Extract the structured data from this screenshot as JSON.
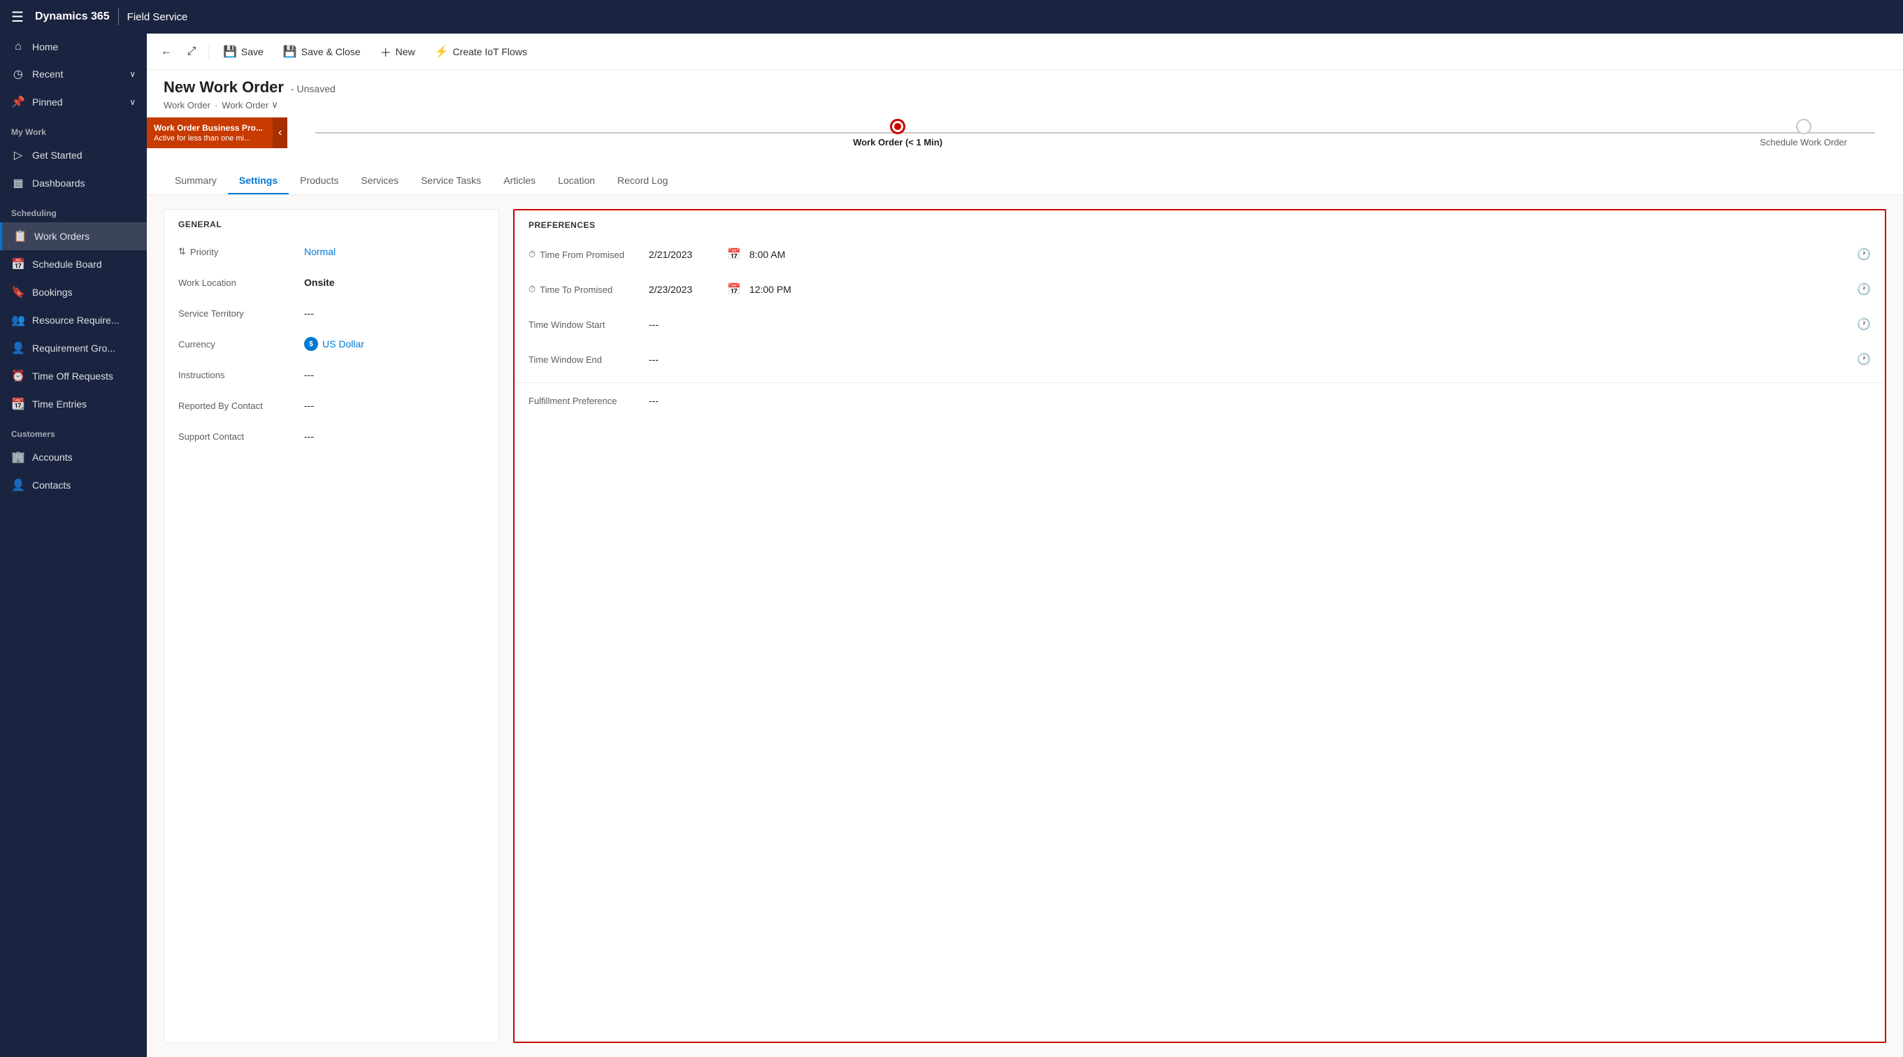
{
  "topNav": {
    "hamburger": "☰",
    "title": "Dynamics 365",
    "appName": "Field Service"
  },
  "sidebar": {
    "items": [
      {
        "id": "home",
        "icon": "⌂",
        "label": "Home",
        "expand": false
      },
      {
        "id": "recent",
        "icon": "◷",
        "label": "Recent",
        "expand": true
      },
      {
        "id": "pinned",
        "icon": "📌",
        "label": "Pinned",
        "expand": true
      }
    ],
    "sections": [
      {
        "label": "My Work",
        "items": [
          {
            "id": "get-started",
            "icon": "▷",
            "label": "Get Started"
          },
          {
            "id": "dashboards",
            "icon": "▦",
            "label": "Dashboards"
          }
        ]
      },
      {
        "label": "Scheduling",
        "items": [
          {
            "id": "work-orders",
            "icon": "📋",
            "label": "Work Orders",
            "active": true
          },
          {
            "id": "schedule-board",
            "icon": "📅",
            "label": "Schedule Board"
          },
          {
            "id": "bookings",
            "icon": "🔖",
            "label": "Bookings"
          },
          {
            "id": "resource-requirements",
            "icon": "👥",
            "label": "Resource Require..."
          },
          {
            "id": "requirement-groups",
            "icon": "👤",
            "label": "Requirement Gro..."
          },
          {
            "id": "time-off-requests",
            "icon": "⏰",
            "label": "Time Off Requests"
          },
          {
            "id": "time-entries",
            "icon": "📆",
            "label": "Time Entries"
          }
        ]
      },
      {
        "label": "Customers",
        "items": [
          {
            "id": "accounts",
            "icon": "🏢",
            "label": "Accounts"
          },
          {
            "id": "contacts",
            "icon": "👤",
            "label": "Contacts"
          }
        ]
      }
    ]
  },
  "commandBar": {
    "backLabel": "←",
    "popoutLabel": "⤢",
    "saveLabel": "Save",
    "saveCloseLabel": "Save & Close",
    "newLabel": "New",
    "iotLabel": "Create IoT Flows"
  },
  "pageHeader": {
    "title": "New Work Order",
    "unsaved": "- Unsaved",
    "breadcrumb1": "Work Order",
    "breadcrumb2": "Work Order"
  },
  "progressBar": {
    "badge": "Work Order Business Pro...",
    "badgeSub": "Active for less than one mi...",
    "activeLabel": "Work Order (< 1 Min)",
    "inactiveLabel": "Schedule Work Order"
  },
  "tabs": [
    {
      "id": "summary",
      "label": "Summary",
      "active": false
    },
    {
      "id": "settings",
      "label": "Settings",
      "active": true
    },
    {
      "id": "products",
      "label": "Products",
      "active": false
    },
    {
      "id": "services",
      "label": "Services",
      "active": false
    },
    {
      "id": "service-tasks",
      "label": "Service Tasks",
      "active": false
    },
    {
      "id": "articles",
      "label": "Articles",
      "active": false
    },
    {
      "id": "location",
      "label": "Location",
      "active": false
    },
    {
      "id": "record-log",
      "label": "Record Log",
      "active": false
    }
  ],
  "general": {
    "sectionTitle": "GENERAL",
    "fields": [
      {
        "label": "Priority",
        "value": "Normal",
        "type": "link",
        "hasIcon": true
      },
      {
        "label": "Work Location",
        "value": "Onsite",
        "type": "bold"
      },
      {
        "label": "Service Territory",
        "value": "---",
        "type": "text"
      },
      {
        "label": "Currency",
        "value": "US Dollar",
        "type": "link",
        "hasCurrencyIcon": true
      },
      {
        "label": "Instructions",
        "value": "---",
        "type": "text"
      },
      {
        "label": "Reported By Contact",
        "value": "---",
        "type": "text"
      },
      {
        "label": "Support Contact",
        "value": "---",
        "type": "text"
      }
    ]
  },
  "preferences": {
    "sectionTitle": "PREFERENCES",
    "fields": [
      {
        "label": "Time From Promised",
        "date": "2/21/2023",
        "time": "8:00 AM",
        "hasIcon": true,
        "type": "datetime"
      },
      {
        "label": "Time To Promised",
        "date": "2/23/2023",
        "time": "12:00 PM",
        "hasIcon": true,
        "type": "datetime"
      },
      {
        "label": "Time Window Start",
        "date": "---",
        "time": "",
        "hasIcon": false,
        "type": "empty"
      },
      {
        "label": "Time Window End",
        "date": "---",
        "time": "",
        "hasIcon": false,
        "type": "empty"
      }
    ],
    "fulfillment": {
      "label": "Fulfillment Preference",
      "value": "---"
    }
  }
}
